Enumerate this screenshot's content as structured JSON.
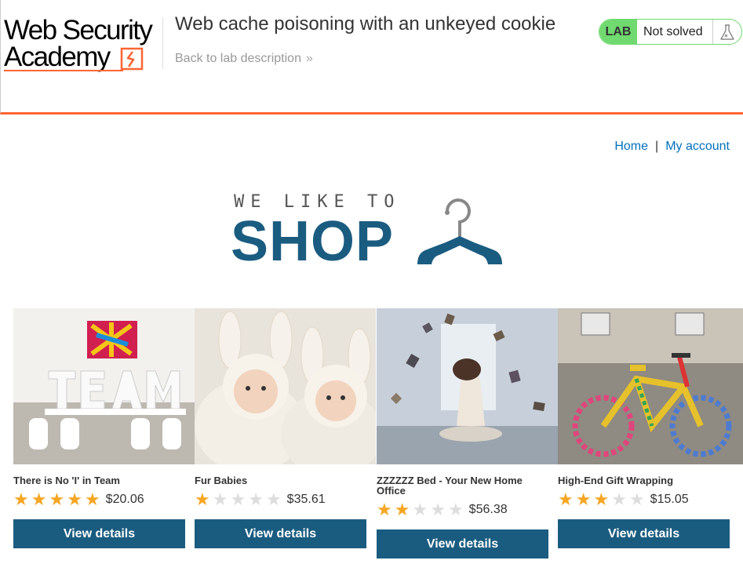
{
  "header": {
    "logo_line1": "Web Security",
    "logo_line2": "Academy",
    "lab_title": "Web cache poisoning with an unkeyed cookie",
    "back_link": "Back to lab description",
    "lab_badge": "LAB",
    "lab_status": "Not solved",
    "colors": {
      "accent": "#ff6633",
      "status_green": "#70d96f"
    }
  },
  "nav": {
    "home": "Home",
    "separator": "|",
    "my_account": "My account"
  },
  "banner": {
    "small_text": "WE LIKE TO",
    "big_text": "SHOP",
    "color": "#1a5c80"
  },
  "products": [
    {
      "name": "There is No 'I' in Team",
      "rating": 5,
      "price": "$20.06",
      "button": "View details"
    },
    {
      "name": "Fur Babies",
      "rating": 1,
      "price": "$35.61",
      "button": "View details"
    },
    {
      "name": "ZZZZZZ Bed - Your New Home Office",
      "rating": 2,
      "price": "$56.38",
      "button": "View details"
    },
    {
      "name": "High-End Gift Wrapping",
      "rating": 3,
      "price": "$15.05",
      "button": "View details"
    }
  ]
}
